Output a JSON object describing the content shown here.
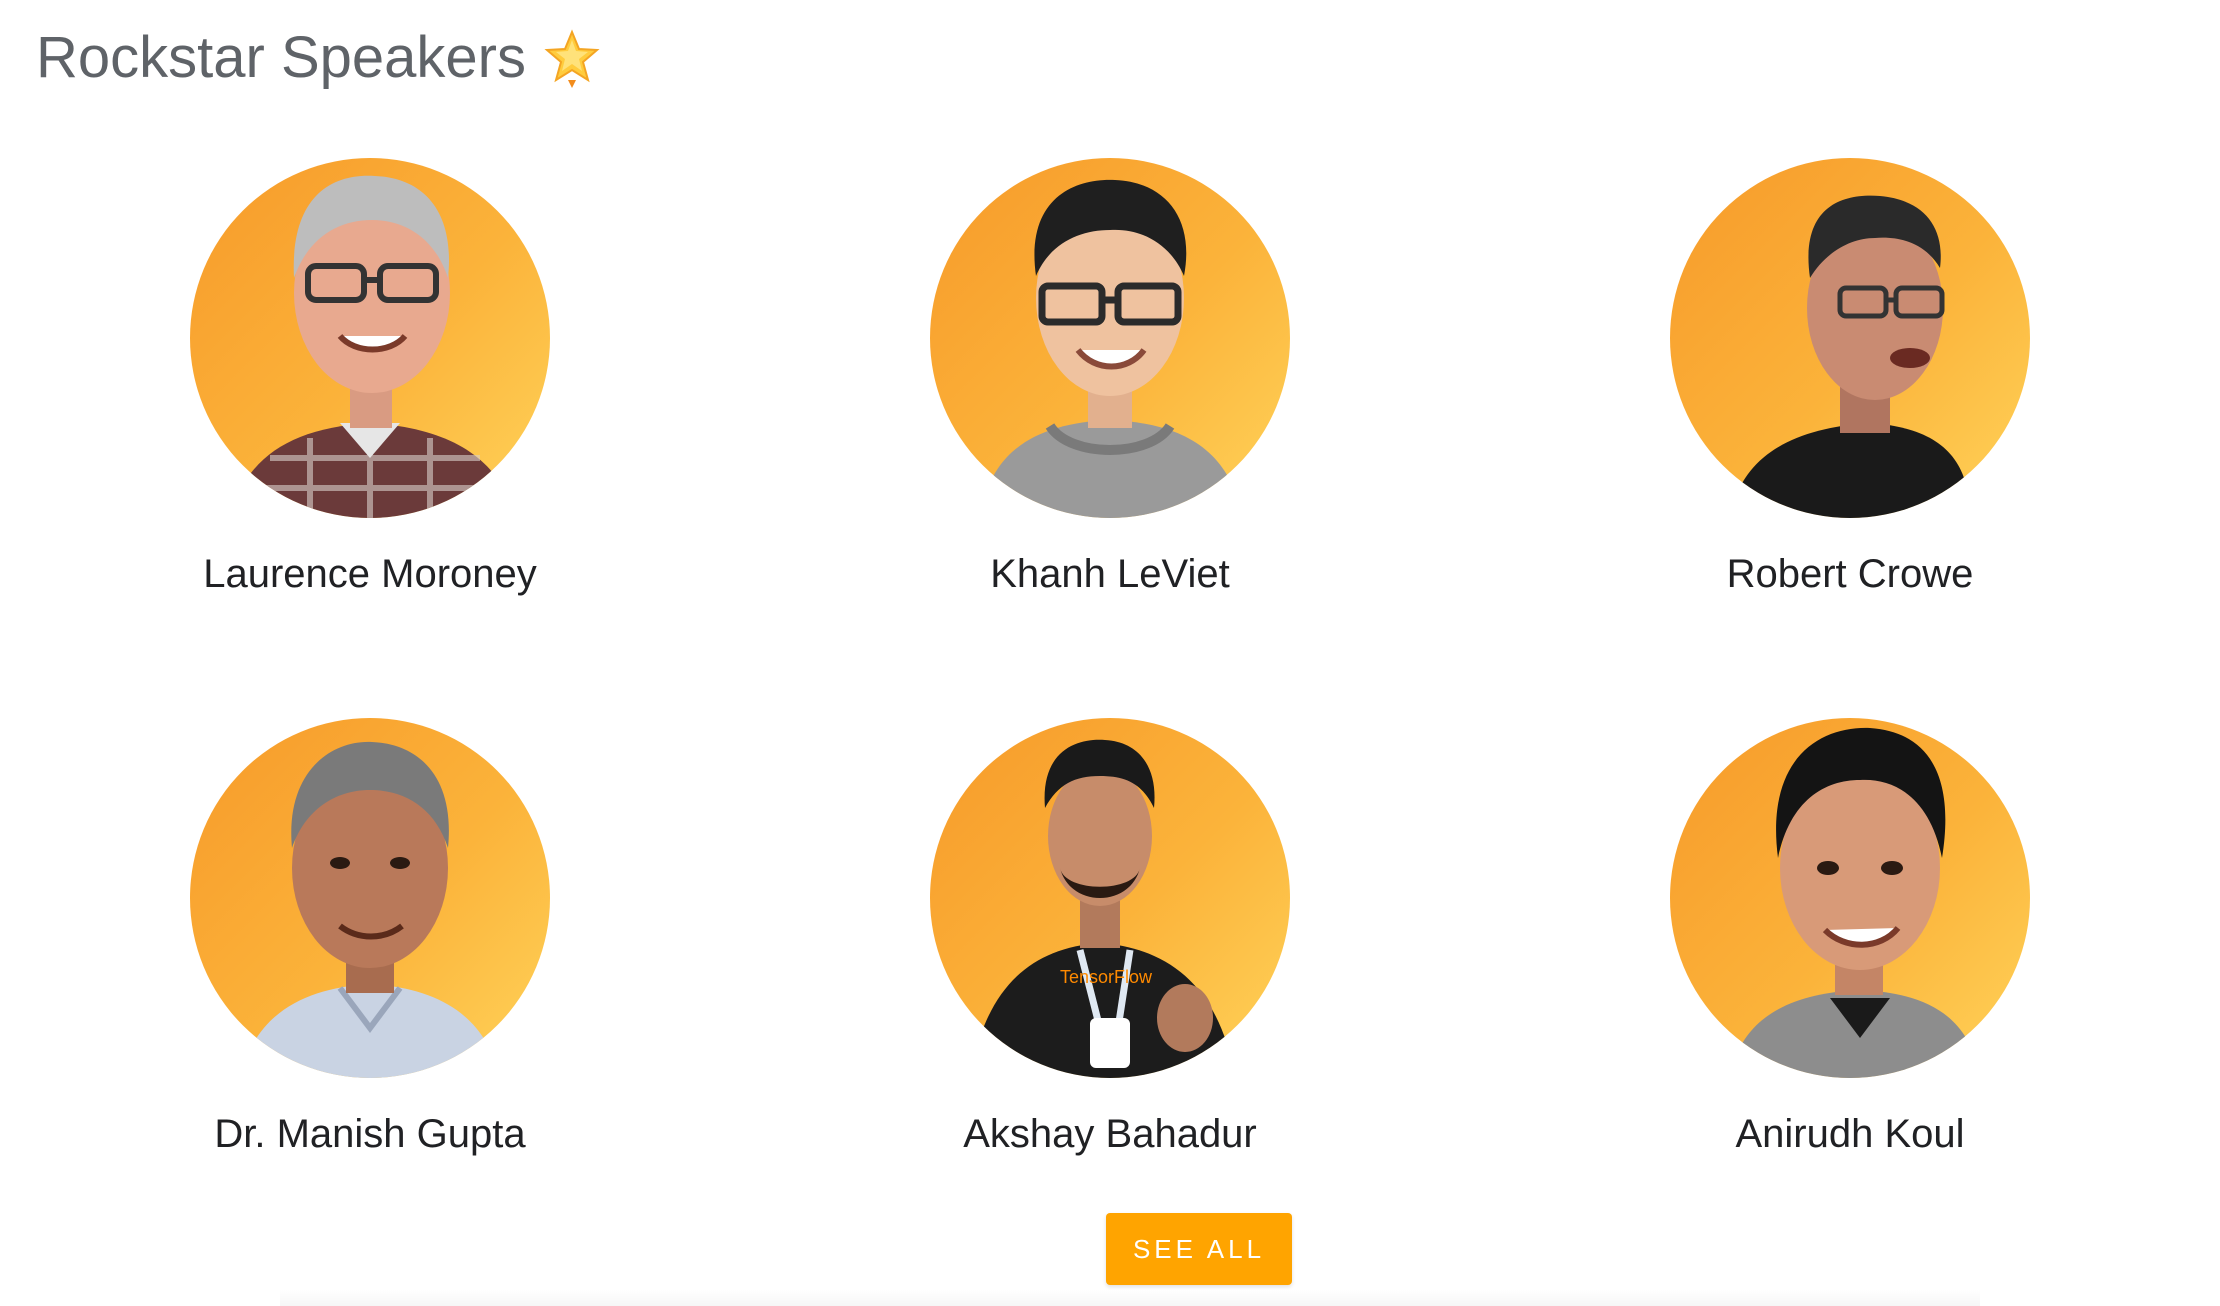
{
  "section": {
    "title": "Rockstar Speakers",
    "title_icon": "glowing-star-icon"
  },
  "speakers": [
    {
      "name": "Laurence Moroney"
    },
    {
      "name": "Khanh LeViet"
    },
    {
      "name": "Robert Crowe"
    },
    {
      "name": "Dr. Manish Gupta"
    },
    {
      "name": "Akshay Bahadur"
    },
    {
      "name": "Anirudh Koul"
    }
  ],
  "actions": {
    "see_all_label": "SEE ALL"
  },
  "colors": {
    "avatar_gradient_start": "#f79a2a",
    "avatar_gradient_end": "#ffd35a",
    "button_background": "#ffa400",
    "title_text": "#5f6368",
    "name_text": "#202124"
  }
}
